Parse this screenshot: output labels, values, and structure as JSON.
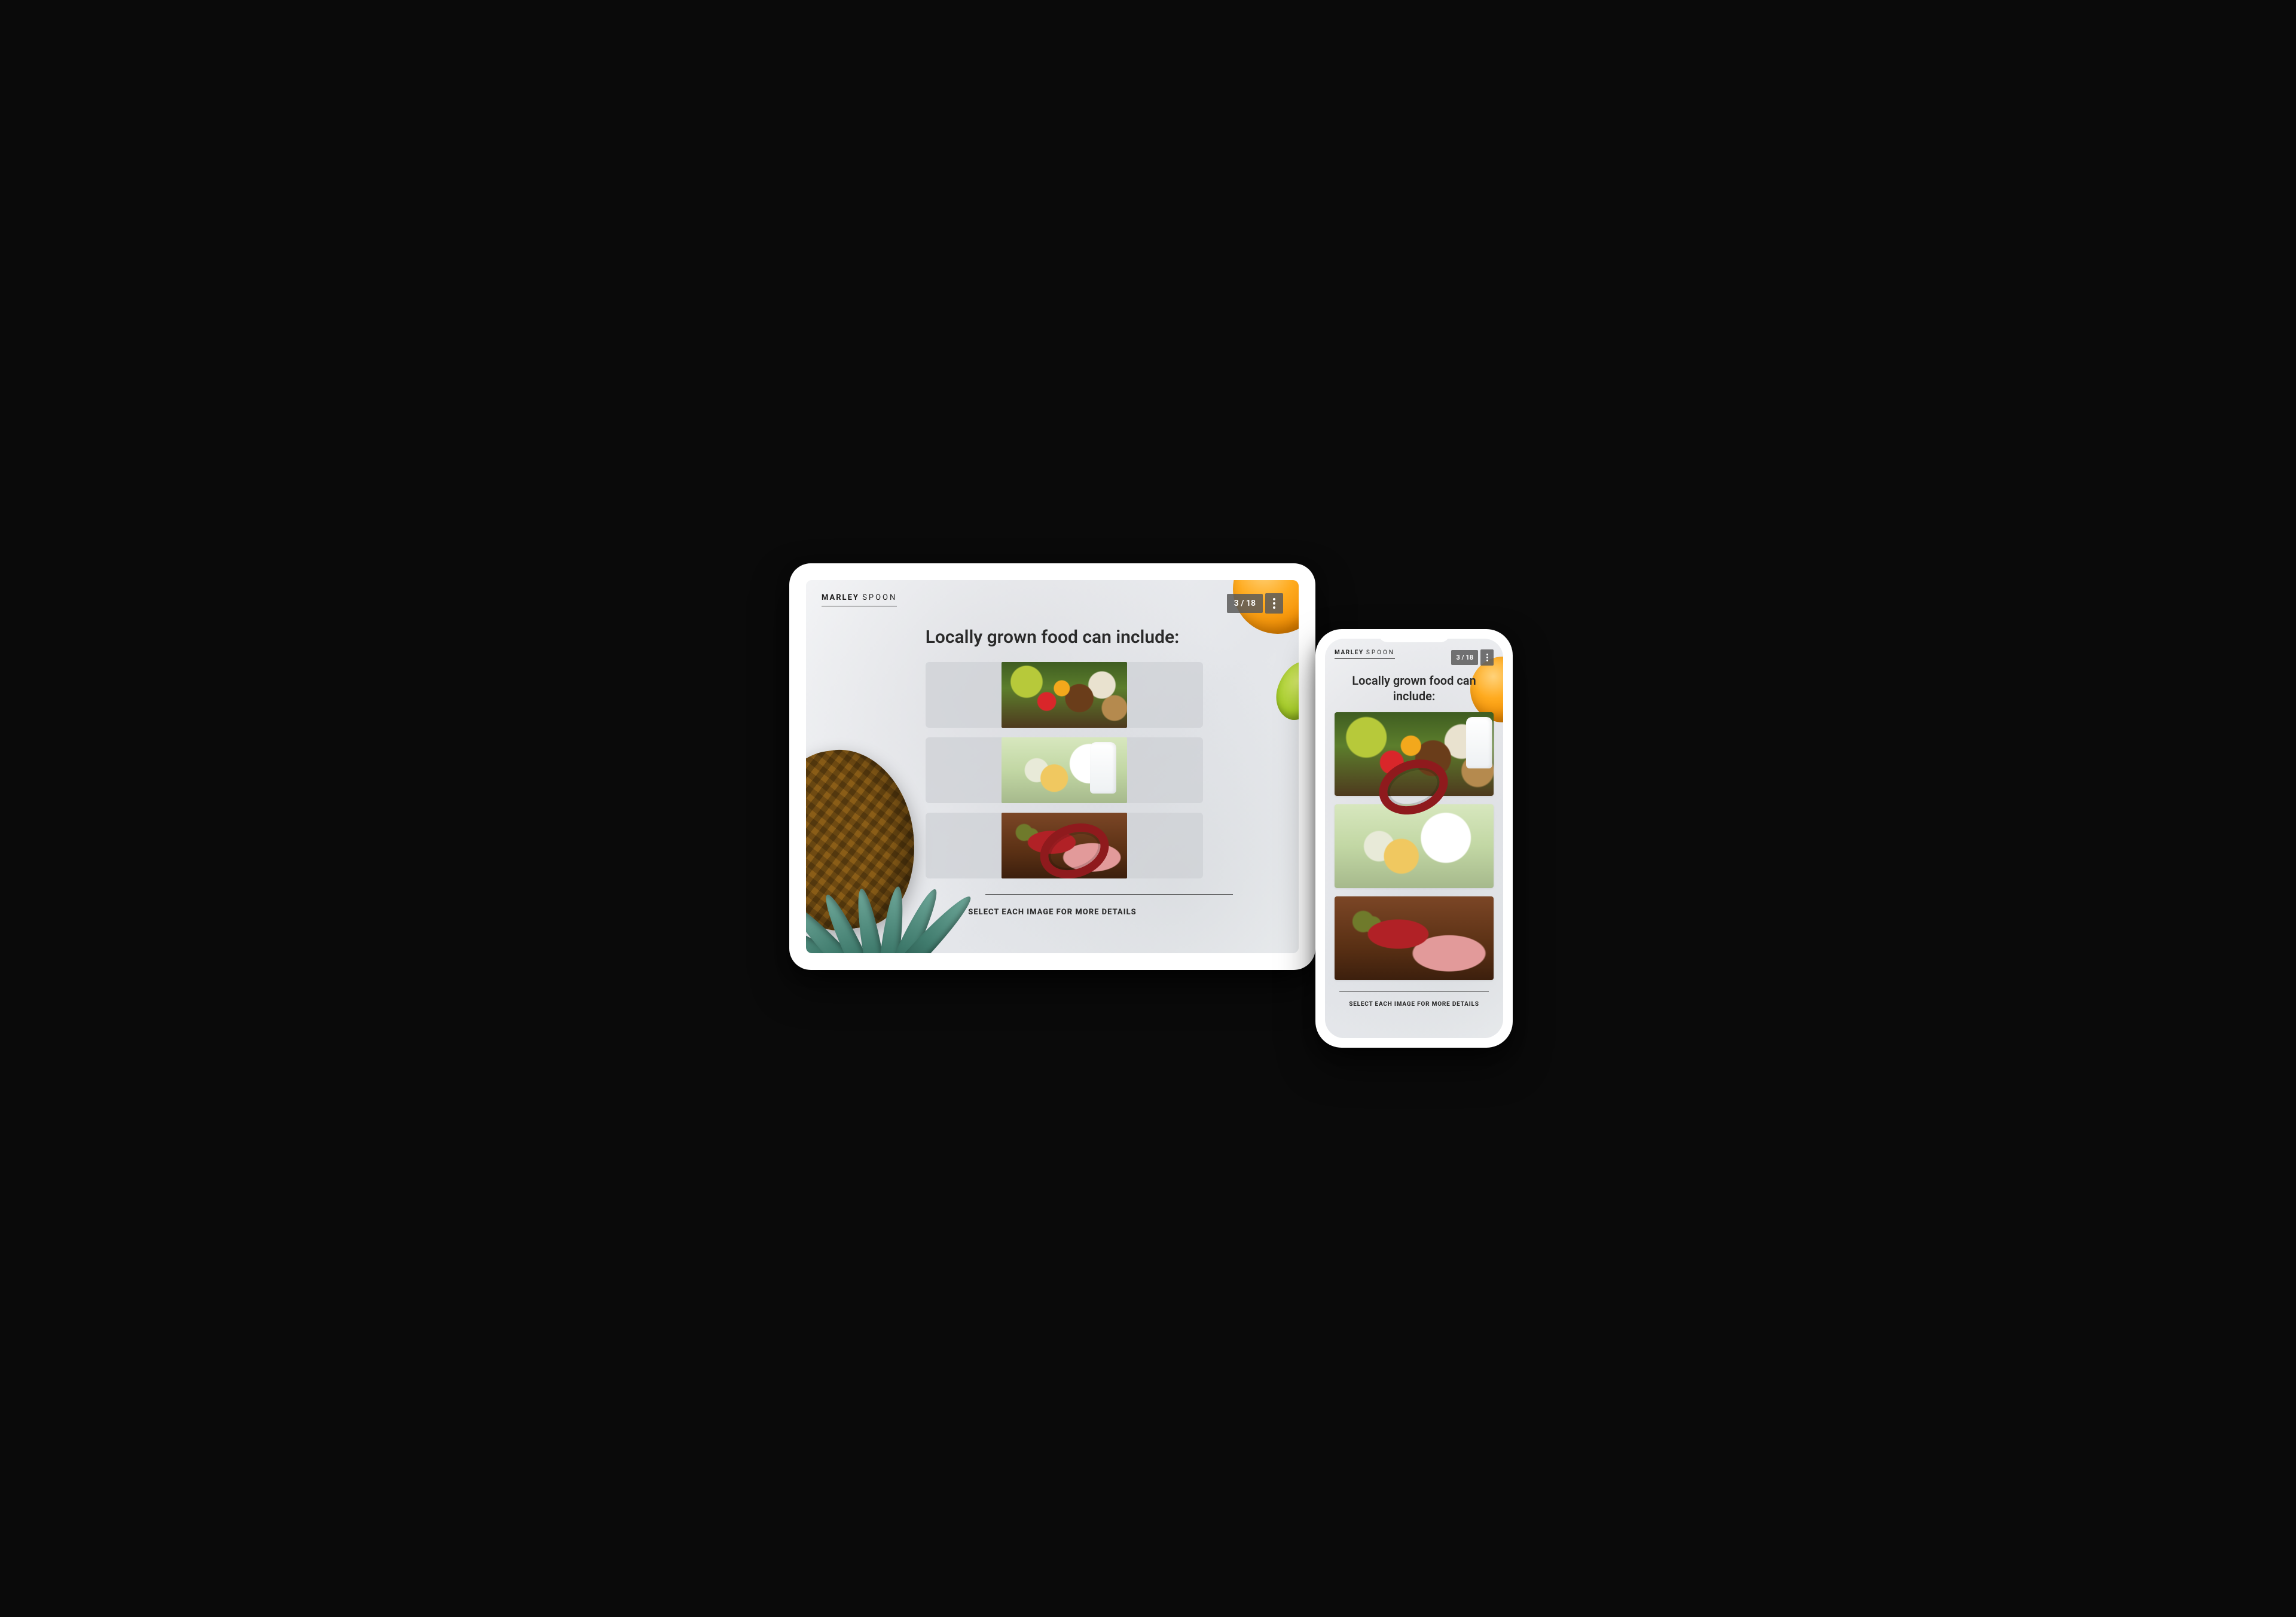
{
  "brand": {
    "word1": "MARLEY",
    "word2": "SPOON"
  },
  "pager": {
    "text": "3 / 18"
  },
  "question": "Locally grown food can include:",
  "options": [
    {
      "id": "produce",
      "alt": "Assorted vegetables, bread and grains"
    },
    {
      "id": "dairy",
      "alt": "Cheese, milk and dairy products"
    },
    {
      "id": "meats",
      "alt": "Cured meats and charcuterie board"
    }
  ],
  "instruction": "SELECT EACH IMAGE FOR MORE DETAILS"
}
